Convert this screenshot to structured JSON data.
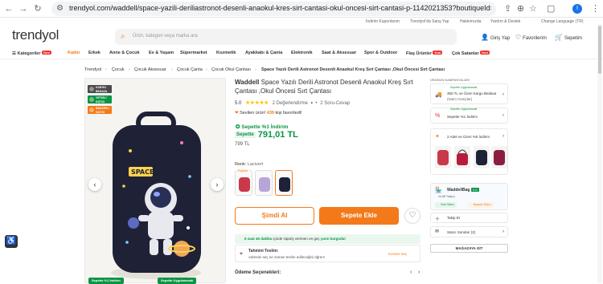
{
  "browser": {
    "url": "trendyol.com/waddell/space-yazili-deriliastronot-desenli-anaokul-kres-sirt-cantasi-okul-oncesi-sirt-cantasi-p-1142021353?boutiqueId=61&merchantId...",
    "profile_initial": "I"
  },
  "toplinks": [
    "İndirim Kuponlarım",
    "Trendyol'da Satış Yap",
    "Hakkımızda",
    "Yardım & Destek",
    "Change Language (TR)"
  ],
  "header": {
    "logo": "trendyol",
    "search_placeholder": "Ürün, kategori veya marka ara",
    "login": "Giriş Yap",
    "favorites": "Favorilerim",
    "cart": "Sepetim"
  },
  "categories": [
    {
      "label": "Kategoriler",
      "badge": "Yeni"
    },
    {
      "label": "Kadın",
      "badge": ""
    },
    {
      "label": "Erkek",
      "badge": ""
    },
    {
      "label": "Anne & Çocuk",
      "badge": ""
    },
    {
      "label": "Ev & Yaşam",
      "badge": ""
    },
    {
      "label": "Süpermarket",
      "badge": ""
    },
    {
      "label": "Kozmetik",
      "badge": ""
    },
    {
      "label": "Ayakkabı & Çanta",
      "badge": ""
    },
    {
      "label": "Elektronik",
      "badge": ""
    },
    {
      "label": "Saat & Aksesuar",
      "badge": ""
    },
    {
      "label": "Spor & Outdoor",
      "badge": ""
    },
    {
      "label": "Flaş Ürünler",
      "badge": "Yeni"
    },
    {
      "label": "Çok Satanlar",
      "badge": "Yeni"
    }
  ],
  "breadcrumbs": [
    "Trendyol",
    "Çocuk",
    "Çocuk Aksesuar",
    "Çocuk Çanta",
    "Çocuk Okul Çantası",
    "Space Yazılı Derili Astronot Desenli Anaokul Kreş Sırt Çantası ,Okul Öncesi Sırt Çantası"
  ],
  "gallery": {
    "tags": [
      "KARGO BEDAVA",
      "YETKİLİ SATICI",
      "BAŞARILI SATICI"
    ],
    "bottom_badges": [
      "Sepette %1 İndirim",
      "Sepette Uygulanacak"
    ]
  },
  "product": {
    "brand": "Waddell",
    "title": "Space Yazılı Derili Astronot Desenli Anaokul Kreş Sırt Çantası ,Okul Öncesi Sırt Çantası",
    "rating": "5.0",
    "stars": "★★★★★",
    "reviews": "2 Değerlendirme",
    "questions": "2 Soru-Cevap",
    "fav_prefix": "Sevilen ürün!",
    "fav_count": "439",
    "fav_suffix": "kişi favoriledi!",
    "discount_text": "Sepette %1 İndirim",
    "price_label": "Sepette",
    "price": "791,01 TL",
    "old_price": "799 TL",
    "color_label": "Renk:",
    "color_value": "Lacivert",
    "popular": "Popüler",
    "buy_now": "Şimdi Al",
    "add_cart": "Sepete Ekle",
    "ship_prefix": "6 saat 45 dakika",
    "ship_mid": "içinde sipariş verirsen en geç",
    "ship_date": "yarın kargoda!",
    "delivery_title": "Tahmini Teslim:",
    "delivery_text": "Adresini seç ne zaman teslim edileceğini öğren!",
    "delivery_link": "Konum Seç",
    "payment": "Ödeme Seçenekleri:"
  },
  "right": {
    "section_title": "ÜRÜNÜN KAMPANYALARI",
    "campaign_badge": "Sepette Uygulanacak",
    "campaign1": "350 TL ve Üzeri Kargo Bedava",
    "campaign1_sub": "(Satıcı Karşılar)",
    "campaign2": "Sepette %1 İndirim",
    "campaign3": "2 Adet ve Üzeri %5 İndirim",
    "seller": "WaddellBag",
    "seller_score": "9.6",
    "followers": "44,6B Takipçi",
    "seller_badges": [
      "Hızlı Satıcı",
      "Başarılı Satıcı"
    ],
    "follow": "Takip Et",
    "seller_questions": "Satıcı Soruları (2)",
    "store_button": "MAĞAZAYA GİT"
  },
  "colors": {
    "accent": "#f27a1a",
    "green": "#0b9444",
    "bag": "#1f2236"
  }
}
